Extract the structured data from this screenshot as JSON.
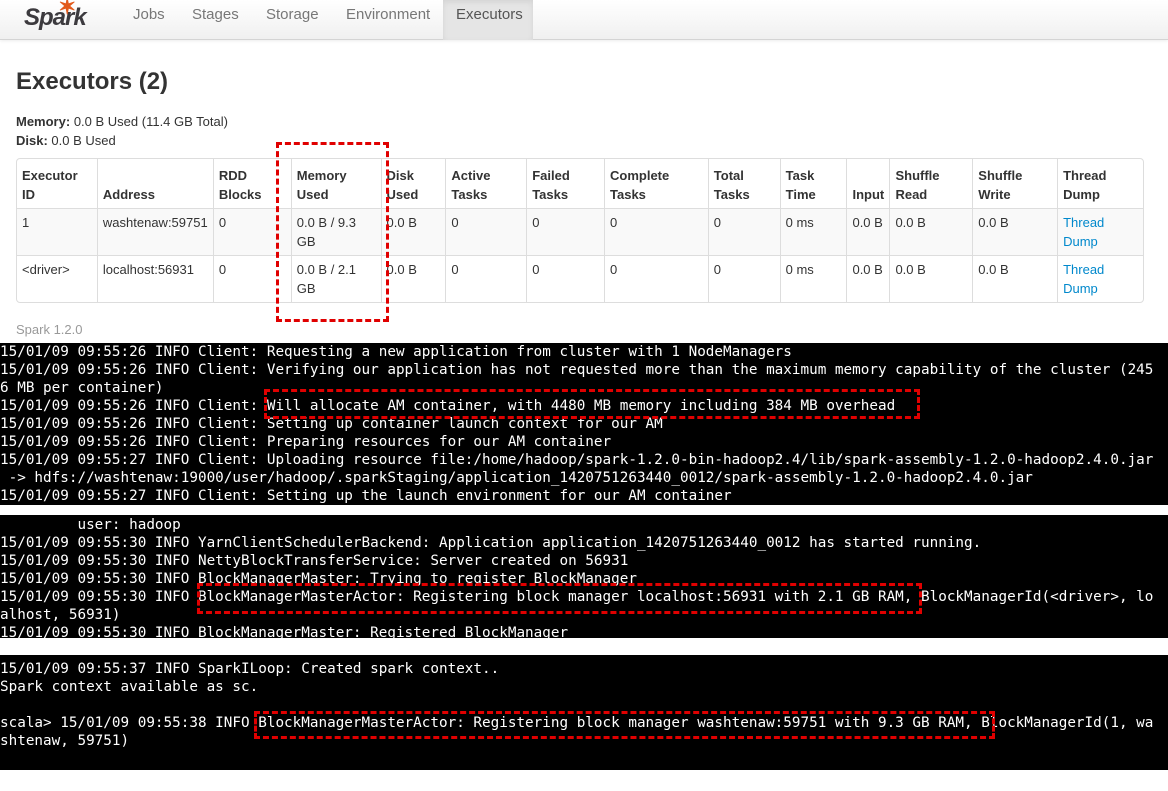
{
  "nav": {
    "logo": "Spark",
    "tabs": [
      "Jobs",
      "Stages",
      "Storage",
      "Environment",
      "Executors"
    ],
    "active": "Executors"
  },
  "page": {
    "title": "Executors (2)",
    "memory_label": "Memory:",
    "memory_value": "0.0 B Used (11.4 GB Total)",
    "disk_label": "Disk:",
    "disk_value": "0.0 B Used",
    "version": "Spark 1.2.0"
  },
  "table": {
    "headers": [
      "Executor ID",
      "Address",
      "RDD Blocks",
      "Memory Used",
      "Disk Used",
      "Active Tasks",
      "Failed Tasks",
      "Complete Tasks",
      "Total Tasks",
      "Task Time",
      "Input",
      "Shuffle Read",
      "Shuffle Write",
      "Thread Dump"
    ],
    "rows": [
      [
        "1",
        "washtenaw:59751",
        "0",
        "0.0 B / 9.3 GB",
        "0.0 B",
        "0",
        "0",
        "0",
        "0",
        "0 ms",
        "0.0 B",
        "0.0 B",
        "0.0 B",
        "Thread Dump"
      ],
      [
        "<driver>",
        "localhost:56931",
        "0",
        "0.0 B / 2.1 GB",
        "0.0 B",
        "0",
        "0",
        "0",
        "0",
        "0 ms",
        "0.0 B",
        "0.0 B",
        "0.0 B",
        "Thread Dump"
      ]
    ]
  },
  "terminal": {
    "block1": [
      "15/01/09 09:55:26 INFO Client: Requesting a new application from cluster with 1 NodeManagers",
      "15/01/09 09:55:26 INFO Client: Verifying our application has not requested more than the maximum memory capability of the cluster (245",
      "6 MB per container)",
      "15/01/09 09:55:26 INFO Client: Will allocate AM container, with 4480 MB memory including 384 MB overhead",
      "15/01/09 09:55:26 INFO Client: Setting up container launch context for our AM",
      "15/01/09 09:55:26 INFO Client: Preparing resources for our AM container",
      "15/01/09 09:55:27 INFO Client: Uploading resource file:/home/hadoop/spark-1.2.0-bin-hadoop2.4/lib/spark-assembly-1.2.0-hadoop2.4.0.jar",
      " -> hdfs://washtenaw:19000/user/hadoop/.sparkStaging/application_1420751263440_0012/spark-assembly-1.2.0-hadoop2.4.0.jar",
      "15/01/09 09:55:27 INFO Client: Setting up the launch environment for our AM container"
    ],
    "block2": [
      "         user: hadoop",
      "15/01/09 09:55:30 INFO YarnClientSchedulerBackend: Application application_1420751263440_0012 has started running.",
      "15/01/09 09:55:30 INFO NettyBlockTransferService: Server created on 56931",
      "15/01/09 09:55:30 INFO BlockManagerMaster: Trying to register BlockManager",
      "15/01/09 09:55:30 INFO BlockManagerMasterActor: Registering block manager localhost:56931 with 2.1 GB RAM, BlockManagerId(<driver>, lo",
      "alhost, 56931)",
      "15/01/09 09:55:30 INFO BlockManagerMaster: Registered BlockManager"
    ],
    "block3": [
      "15/01/09 09:55:37 INFO SparkILoop: Created spark context..",
      "Spark context available as sc.",
      "",
      "scala> 15/01/09 09:55:38 INFO BlockManagerMasterActor: Registering block manager washtenaw:59751 with 9.3 GB RAM, BlockManagerId(1, wa",
      "shtenaw, 59751)"
    ]
  },
  "colors": {
    "highlight": "#e00000",
    "link": "#0088cc",
    "spark_orange": "#e25a1c"
  }
}
